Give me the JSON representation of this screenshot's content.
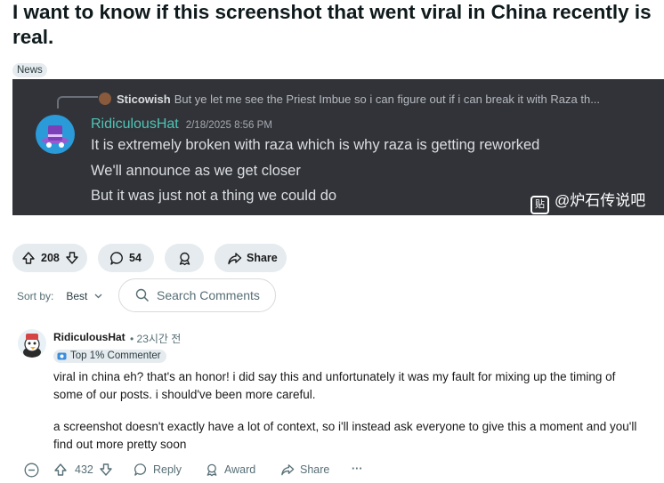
{
  "post": {
    "title": "I want to know if this screenshot that went viral in China recently is real.",
    "flair": "News",
    "upvotes": "208",
    "comments": "54",
    "share_label": "Share"
  },
  "screenshot": {
    "reply_author": "Sticowish",
    "reply_text": "But ye let me see the Priest Imbue so i can figure out if i can break it with Raza th...",
    "author": "RidiculousHat",
    "date": "2/18/2025 8:56 PM",
    "lines": [
      "It is extremely broken with raza which is why raza is getting reworked",
      "We'll announce as we get closer",
      "But it was just not a thing we could do"
    ],
    "watermark_icon": "贴",
    "watermark": "@炉石传说吧"
  },
  "comments_bar": {
    "sort_label": "Sort by:",
    "sort_value": "Best",
    "search_placeholder": "Search Comments"
  },
  "comment": {
    "author": "RidiculousHat",
    "time": "• 23시간 전",
    "badge": "Top 1% Commenter",
    "lines": [
      "viral in china eh? that's an honor! i did say this and unfortunately it was my fault for mixing up the timing of",
      "some of our posts. i should've been more careful.",
      "a screenshot doesn't exactly have a lot of context, so i'll instead ask everyone to give this a moment and you'll",
      "find out more pretty soon"
    ],
    "upvotes": "432",
    "reply_label": "Reply",
    "award_label": "Award",
    "share_label": "Share",
    "more": "···"
  },
  "colors": {
    "discord_bg": "#313338",
    "discord_name": "#4fc4b6",
    "pill_bg": "#e5ebee"
  }
}
